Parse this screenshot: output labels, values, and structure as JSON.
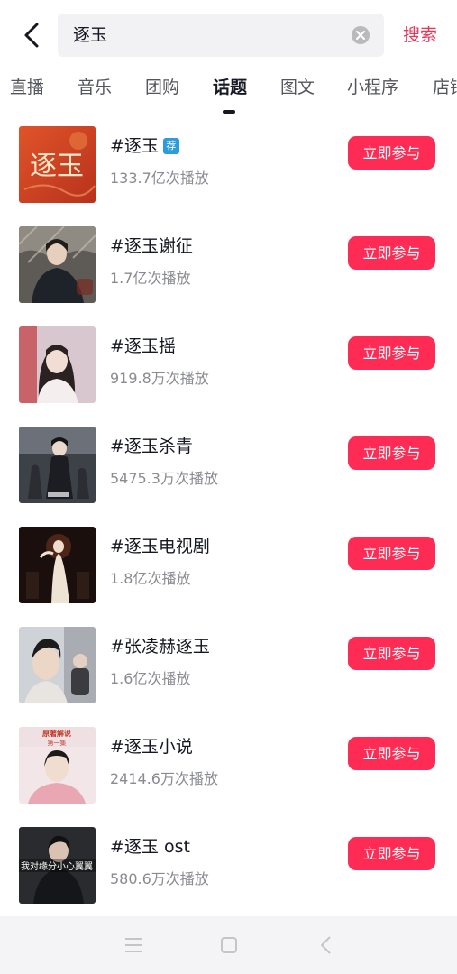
{
  "search": {
    "query": "逐玉",
    "submit_label": "搜索"
  },
  "tabs": [
    {
      "label": "直播",
      "active": false
    },
    {
      "label": "音乐",
      "active": false
    },
    {
      "label": "团购",
      "active": false
    },
    {
      "label": "话题",
      "active": true
    },
    {
      "label": "图文",
      "active": false
    },
    {
      "label": "小程序",
      "active": false
    },
    {
      "label": "店铺",
      "active": false
    }
  ],
  "topics": [
    {
      "title": "#逐玉",
      "badge": "荐",
      "plays": "133.7亿次播放",
      "button": "立即参与"
    },
    {
      "title": "#逐玉谢征",
      "plays": "1.7亿次播放",
      "button": "立即参与"
    },
    {
      "title": "#逐玉摇",
      "plays": "919.8万次播放",
      "button": "立即参与"
    },
    {
      "title": "#逐玉杀青",
      "plays": "5475.3万次播放",
      "button": "立即参与"
    },
    {
      "title": "#逐玉电视剧",
      "plays": "1.8亿次播放",
      "button": "立即参与"
    },
    {
      "title": "#张凌赫逐玉",
      "plays": "1.6亿次播放",
      "button": "立即参与"
    },
    {
      "title": "#逐玉小说",
      "plays": "2414.6万次播放",
      "button": "立即参与"
    },
    {
      "title": "#逐玉 ost",
      "plays": "580.6万次播放",
      "button": "立即参与"
    }
  ],
  "thumb_text": {
    "cover_calligraphy": "逐玉",
    "novel_caption_top": "原著解说",
    "novel_caption_sub": "第一集",
    "ost_caption": "我对缘分小心翼翼"
  },
  "colors": {
    "accent": "#fe2c55",
    "search_link": "#e6395a",
    "badge": "#2d9cdb"
  }
}
